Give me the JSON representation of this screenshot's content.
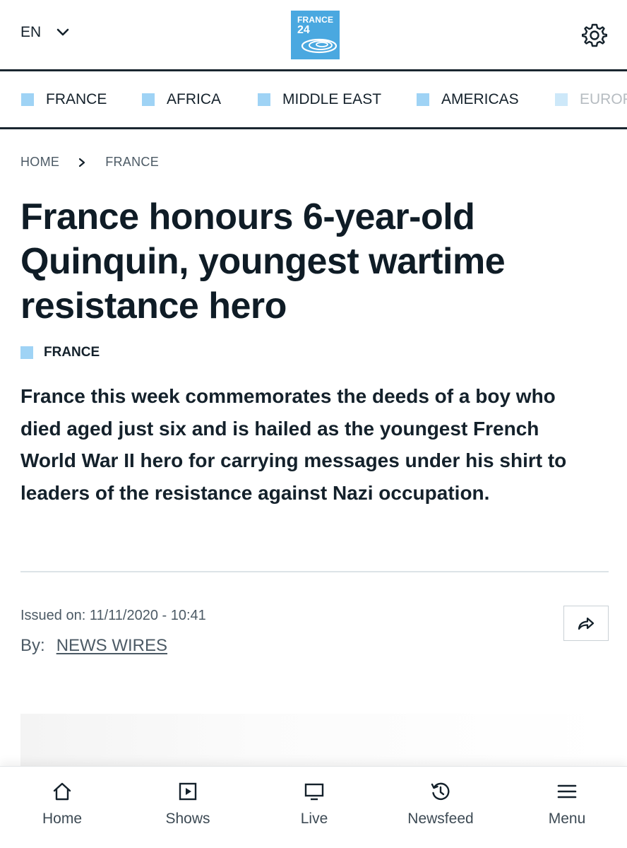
{
  "header": {
    "language": "EN",
    "logo_line1": "FRANCE",
    "logo_line2": "24"
  },
  "sections": [
    {
      "label": "FRANCE"
    },
    {
      "label": "AFRICA"
    },
    {
      "label": "MIDDLE EAST"
    },
    {
      "label": "AMERICAS"
    },
    {
      "label": "EUROPE"
    }
  ],
  "breadcrumb": {
    "home": "HOME",
    "current": "FRANCE"
  },
  "article": {
    "title": "France honours 6-year-old Quinquin, youngest wartime resistance hero",
    "tag": "FRANCE",
    "lead": "France this week commemorates the deeds of a boy who died aged just six and is hailed as the youngest French World War II hero for carrying messages under his shirt to leaders of the resistance against Nazi occupation.",
    "issued": "Issued on: 11/11/2020 - 10:41",
    "by_label": "By:",
    "author": "NEWS WIRES"
  },
  "bottom_nav": [
    {
      "label": "Home",
      "icon": "home-icon"
    },
    {
      "label": "Shows",
      "icon": "play-icon"
    },
    {
      "label": "Live",
      "icon": "monitor-icon"
    },
    {
      "label": "Newsfeed",
      "icon": "history-icon"
    },
    {
      "label": "Menu",
      "icon": "hamburger-icon"
    }
  ],
  "colors": {
    "accent": "#4aa8e0",
    "section_square": "#9fd3f5",
    "text": "#14212b"
  }
}
